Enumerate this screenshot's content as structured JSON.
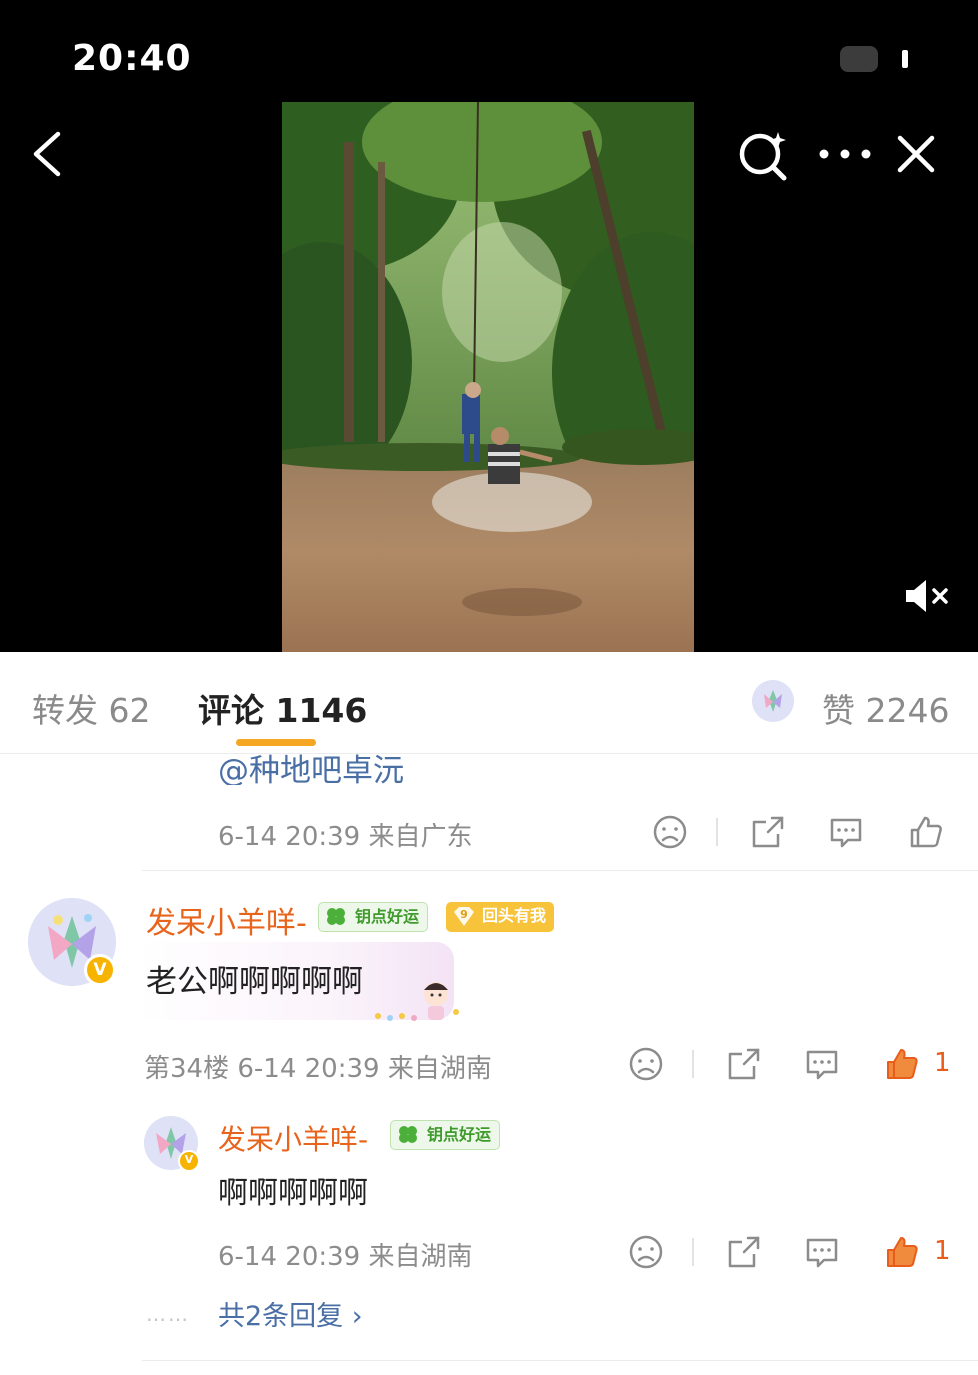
{
  "status_bar": {
    "time": "20:40"
  },
  "tabs": {
    "forward": "转发 62",
    "comments": "评论 1146",
    "likes": "赞 2246"
  },
  "prev_comment": {
    "mention": "@种地吧卓沅",
    "meta": "6-14 20:39 来自广东"
  },
  "comment": {
    "username": "发呆小羊咩-",
    "badge_luck": "钥点好运",
    "badge_fan": "回头有我",
    "badge_fan_level": "9",
    "text": "老公啊啊啊啊啊",
    "meta": "第34楼 6-14 20:39 来自湖南",
    "like_count": "1",
    "verified_mark": "V"
  },
  "reply": {
    "username": "发呆小羊咩-",
    "badge_luck": "钥点好运",
    "text": "啊啊啊啊啊",
    "meta": "6-14 20:39 来自湖南",
    "like_count": "1",
    "verified_mark": "V"
  },
  "more_replies": {
    "dots": "……",
    "label": "共2条回复 ›"
  },
  "colors": {
    "accent": "#f5a623",
    "username": "#e8641d",
    "link": "#4a6fa5",
    "like_active": "#e85d1c"
  }
}
